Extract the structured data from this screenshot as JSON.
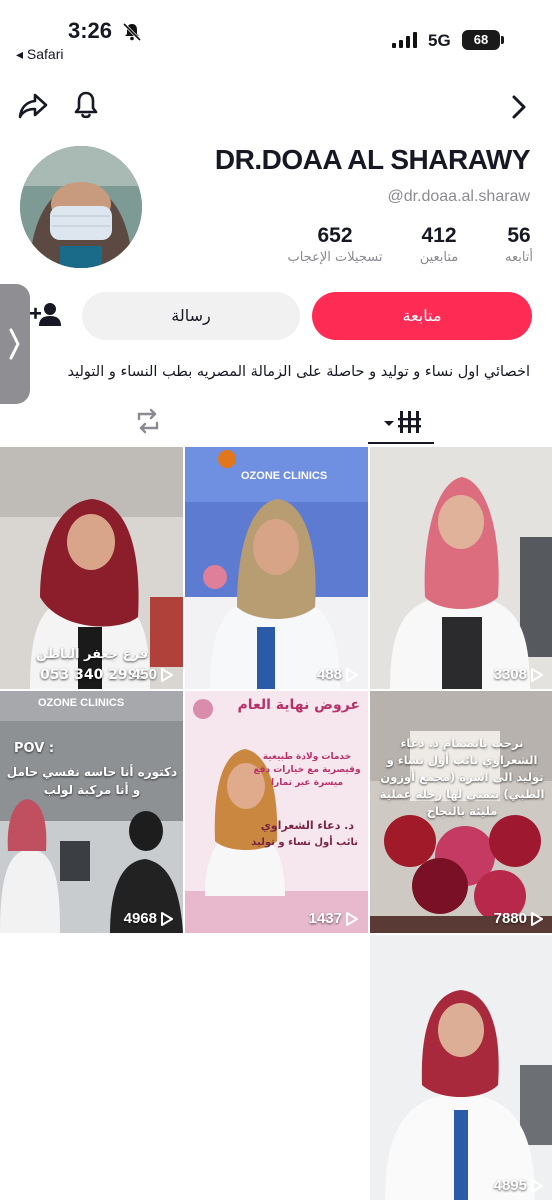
{
  "status_bar": {
    "time": "3:26",
    "back_label": "◂ Safari",
    "network": "5G",
    "battery": "68"
  },
  "profile": {
    "display_name": "DR.DOAA AL SHARAWY",
    "handle": "@dr.doaa.al.sharaw",
    "stats": {
      "following_count": "56",
      "following_label": "أتابعه",
      "followers_count": "412",
      "followers_label": "متابعين",
      "likes_count": "652",
      "likes_label": "تسجيلات الإعجاب"
    },
    "bio": "اخصائي اول نساء و توليد و حاصلة على الزمالة المصريه بطب النساء و التوليد"
  },
  "actions": {
    "follow_label": "متابعة",
    "message_label": "رسالة"
  },
  "colors": {
    "accent": "#fe2c55",
    "secondary_button": "#f1f1f2",
    "muted_text": "#8a8b91"
  },
  "videos": [
    {
      "views": "450",
      "caption_line1": "فرع جعفر الباطن",
      "caption_line2": "053 340 2999"
    },
    {
      "views": "488",
      "brand": "OZONE CLINICS"
    },
    {
      "views": "3308"
    },
    {
      "views": "4968",
      "brand": "OZONE CLINICS",
      "caption_pov": "POV :",
      "caption_text": "دكتوره أنا حاسه نفسي حامل و أنا مركبة لولب"
    },
    {
      "views": "1437",
      "caption_title": "عروض نهاية العام",
      "caption_sub": "خدمات ولادة طبيعية وقيصرية مع خيارات دفع ميسرة عبر تمارا",
      "caption_name": "د. دعاء الشعراوي",
      "caption_role": "نائب أول نساء و توليد"
    },
    {
      "views": "7880",
      "caption_text": "نرحب بانضمام د. دعاء الشعراوي نائب أول نساء و توليد الى اسرة (مجمع أوزون الطبي) نتمنى لها رحلة عملية مليئة بالنجاح"
    },
    {
      "views": "4895"
    }
  ]
}
